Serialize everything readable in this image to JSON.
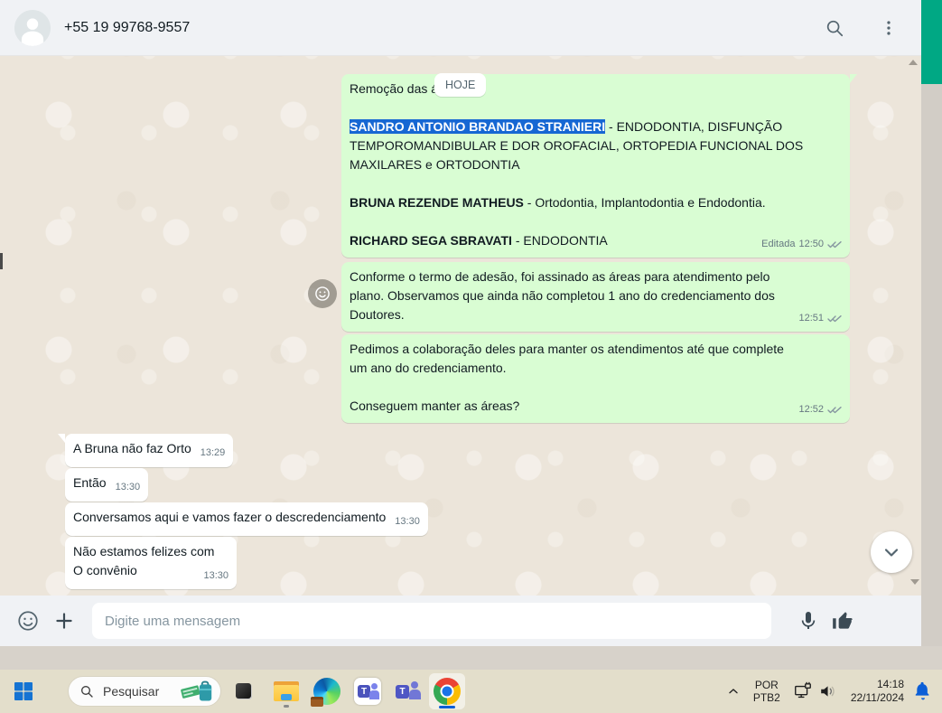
{
  "header": {
    "title": "+55 19 99768-9557"
  },
  "chat": {
    "date_badge": "HOJE",
    "messages": [
      {
        "direction": "out",
        "intro": "Remoção das á",
        "sandro_name": "SANDRO ANTONIO BRANDAO STRANIERI",
        "sandro_rest": " - ENDODONTIA, DISFUNÇÃO",
        "sandro_line2": "TEMPOROMANDIBULAR E DOR OROFACIAL, ORTOPEDIA FUNCIONAL DOS",
        "sandro_line3": "MAXILARES e ORTODONTIA",
        "bruna_name": "BRUNA REZENDE MATHEUS",
        "bruna_rest": " -  Ortodontia, Implantodontia e Endodontia.",
        "richard_name": "RICHARD SEGA SBRAVATI",
        "richard_rest": " - ENDODONTIA",
        "edited": "Editada",
        "time": "12:50",
        "status": "delivered-double-check"
      },
      {
        "direction": "out",
        "lines": [
          "Conforme o termo de adesão, foi assinado as áreas para atendimento pelo",
          "plano. Observamos que ainda não completou 1 ano do credenciamento dos",
          "Doutores."
        ],
        "time": "12:51",
        "status": "delivered-double-check"
      },
      {
        "direction": "out",
        "lines": [
          "Pedimos a colaboração deles para manter os atendimentos até que complete",
          "um ano do credenciamento.",
          "",
          "Conseguem manter as áreas?"
        ],
        "time": "12:52",
        "status": "delivered-double-check"
      },
      {
        "direction": "in",
        "text": "A Bruna não faz Orto",
        "time": "13:29"
      },
      {
        "direction": "in",
        "text": "Então",
        "time": "13:30"
      },
      {
        "direction": "in",
        "text": "Conversamos aqui e vamos fazer o descredenciamento",
        "time": "13:30"
      },
      {
        "direction": "in",
        "line1": "Não estamos felizes com",
        "line2": "O convênio",
        "time": "13:30"
      }
    ]
  },
  "composer": {
    "placeholder": "Digite uma mensagem"
  },
  "taskbar": {
    "search_label": "Pesquisar",
    "language": {
      "line1": "POR",
      "line2": "PTB2"
    },
    "clock": {
      "time": "14:18",
      "date": "22/11/2024"
    }
  },
  "icons": {
    "header": [
      "search-icon",
      "kebab-menu-icon"
    ],
    "composer": [
      "emoji-icon",
      "plus-icon",
      "mic-icon",
      "thumbs-up-icon"
    ],
    "taskbar": [
      "start-icon",
      "search-icon",
      "taskview-icon",
      "explorer-icon",
      "edge-icon",
      "teams-icon",
      "teams-classic-icon",
      "chrome-icon"
    ],
    "tray": [
      "chevron-up-icon",
      "cast-network-icon",
      "speaker-icon",
      "bell-icon"
    ]
  },
  "colors": {
    "accent_green_strip": "#00a884",
    "outgoing_bubble": "#d9fdd3",
    "selection_blue": "#1667d3",
    "tick_gray": "#8696a0",
    "bell_blue": "#0b5ed7"
  }
}
